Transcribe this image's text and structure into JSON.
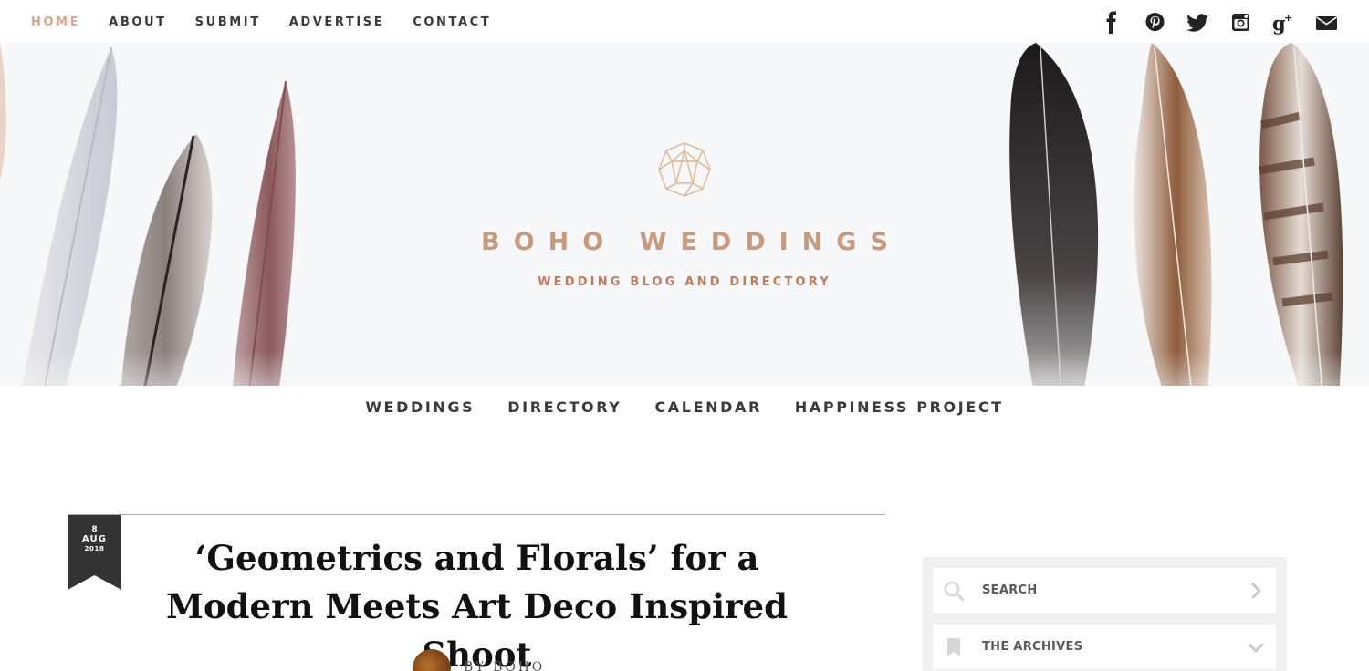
{
  "topnav": {
    "items": [
      {
        "label": "HOME",
        "active": true
      },
      {
        "label": "ABOUT",
        "active": false
      },
      {
        "label": "SUBMIT",
        "active": false
      },
      {
        "label": "ADVERTISE",
        "active": false
      },
      {
        "label": "CONTACT",
        "active": false
      }
    ]
  },
  "social": [
    "facebook-icon",
    "pinterest-icon",
    "twitter-icon",
    "instagram-icon",
    "google-plus-icon",
    "email-icon"
  ],
  "header": {
    "brand": "BOHO WEDDINGS",
    "tagline": "WEDDING BLOG AND DIRECTORY"
  },
  "mainnav": {
    "items": [
      "WEDDINGS",
      "DIRECTORY",
      "CALENDAR",
      "HAPPINESS PROJECT"
    ]
  },
  "post": {
    "date": {
      "day": "8",
      "month": "AUG",
      "year": "2018"
    },
    "title": "‘Geometrics and Florals’ for a Modern Meets Art Deco Inspired Shoot",
    "author": "BY BOHO"
  },
  "sidebar": {
    "search_label": "SEARCH",
    "archives_label": "THE ARCHIVES"
  },
  "colors": {
    "accent": "#d9a58f",
    "brand": "#c79a7c",
    "tagline": "#c17a5c",
    "text_dark": "#3a3a3a",
    "badge": "#333333"
  }
}
